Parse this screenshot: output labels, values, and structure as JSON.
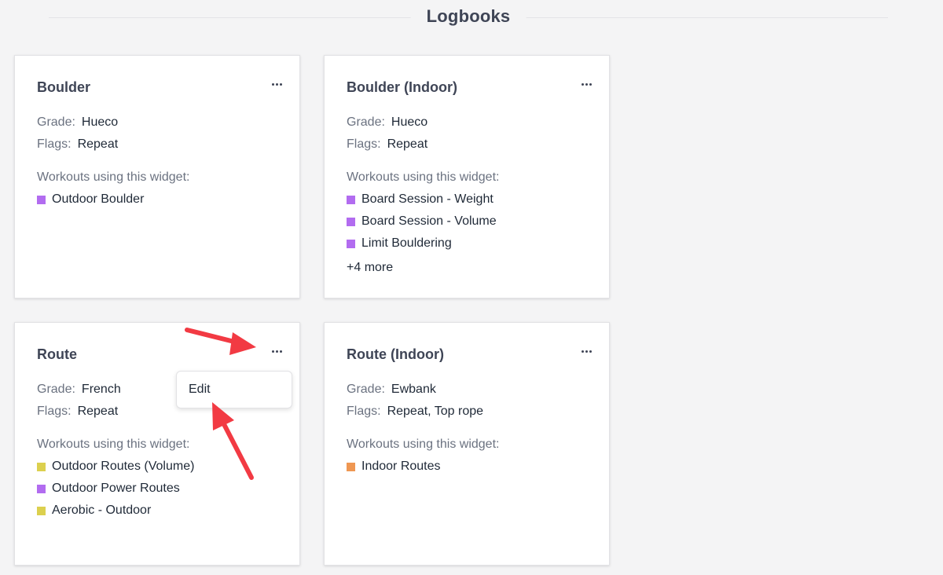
{
  "page": {
    "title": "Logbooks"
  },
  "colors": {
    "purple": "#b26cf0",
    "yellow": "#dcd04e",
    "orange": "#ef9752",
    "annotation_red": "#f23a43"
  },
  "cards": [
    {
      "name": "Boulder",
      "grade_label": "Grade:",
      "grade": "Hueco",
      "flags_label": "Flags:",
      "flags": "Repeat",
      "workouts_label": "Workouts using this widget:",
      "workouts": [
        {
          "name": "Outdoor Boulder",
          "color": "purple"
        }
      ],
      "more": ""
    },
    {
      "name": "Boulder (Indoor)",
      "grade_label": "Grade:",
      "grade": "Hueco",
      "flags_label": "Flags:",
      "flags": "Repeat",
      "workouts_label": "Workouts using this widget:",
      "workouts": [
        {
          "name": "Board Session - Weight",
          "color": "purple"
        },
        {
          "name": "Board Session - Volume",
          "color": "purple"
        },
        {
          "name": "Limit Bouldering",
          "color": "purple"
        }
      ],
      "more": "+4 more"
    },
    {
      "name": "Route",
      "grade_label": "Grade:",
      "grade": "French",
      "flags_label": "Flags:",
      "flags": "Repeat",
      "workouts_label": "Workouts using this widget:",
      "workouts": [
        {
          "name": "Outdoor Routes (Volume)",
          "color": "yellow"
        },
        {
          "name": "Outdoor Power Routes",
          "color": "purple"
        },
        {
          "name": "Aerobic - Outdoor",
          "color": "yellow"
        }
      ],
      "more": ""
    },
    {
      "name": "Route (Indoor)",
      "grade_label": "Grade:",
      "grade": "Ewbank",
      "flags_label": "Flags:",
      "flags": "Repeat, Top rope",
      "workouts_label": "Workouts using this widget:",
      "workouts": [
        {
          "name": "Indoor Routes",
          "color": "orange"
        }
      ],
      "more": ""
    }
  ],
  "menu": {
    "items": [
      "Edit"
    ]
  },
  "icons": {
    "card_menu": "more-horizontal-icon"
  }
}
